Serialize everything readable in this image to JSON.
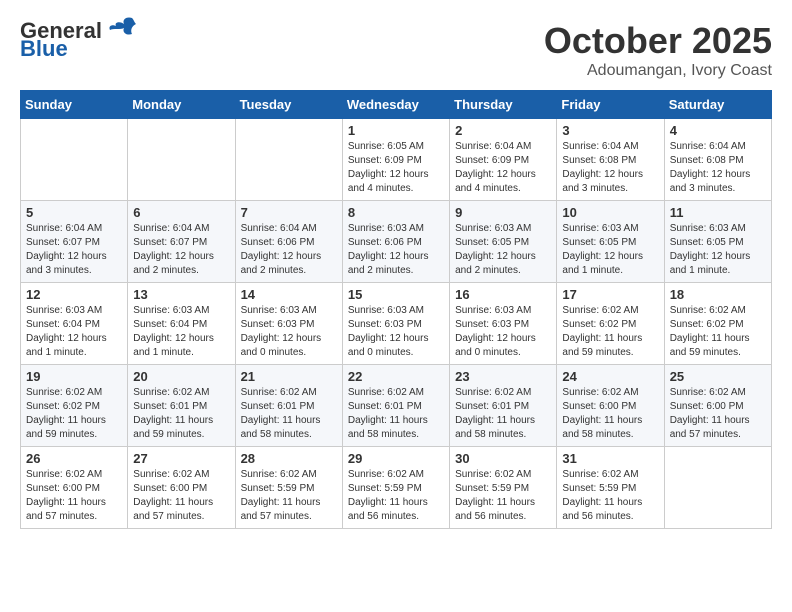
{
  "header": {
    "logo_line1": "General",
    "logo_line2": "Blue",
    "month": "October 2025",
    "location": "Adoumangan, Ivory Coast"
  },
  "weekdays": [
    "Sunday",
    "Monday",
    "Tuesday",
    "Wednesday",
    "Thursday",
    "Friday",
    "Saturday"
  ],
  "weeks": [
    [
      {
        "day": "",
        "content": ""
      },
      {
        "day": "",
        "content": ""
      },
      {
        "day": "",
        "content": ""
      },
      {
        "day": "1",
        "content": "Sunrise: 6:05 AM\nSunset: 6:09 PM\nDaylight: 12 hours\nand 4 minutes."
      },
      {
        "day": "2",
        "content": "Sunrise: 6:04 AM\nSunset: 6:09 PM\nDaylight: 12 hours\nand 4 minutes."
      },
      {
        "day": "3",
        "content": "Sunrise: 6:04 AM\nSunset: 6:08 PM\nDaylight: 12 hours\nand 3 minutes."
      },
      {
        "day": "4",
        "content": "Sunrise: 6:04 AM\nSunset: 6:08 PM\nDaylight: 12 hours\nand 3 minutes."
      }
    ],
    [
      {
        "day": "5",
        "content": "Sunrise: 6:04 AM\nSunset: 6:07 PM\nDaylight: 12 hours\nand 3 minutes."
      },
      {
        "day": "6",
        "content": "Sunrise: 6:04 AM\nSunset: 6:07 PM\nDaylight: 12 hours\nand 2 minutes."
      },
      {
        "day": "7",
        "content": "Sunrise: 6:04 AM\nSunset: 6:06 PM\nDaylight: 12 hours\nand 2 minutes."
      },
      {
        "day": "8",
        "content": "Sunrise: 6:03 AM\nSunset: 6:06 PM\nDaylight: 12 hours\nand 2 minutes."
      },
      {
        "day": "9",
        "content": "Sunrise: 6:03 AM\nSunset: 6:05 PM\nDaylight: 12 hours\nand 2 minutes."
      },
      {
        "day": "10",
        "content": "Sunrise: 6:03 AM\nSunset: 6:05 PM\nDaylight: 12 hours\nand 1 minute."
      },
      {
        "day": "11",
        "content": "Sunrise: 6:03 AM\nSunset: 6:05 PM\nDaylight: 12 hours\nand 1 minute."
      }
    ],
    [
      {
        "day": "12",
        "content": "Sunrise: 6:03 AM\nSunset: 6:04 PM\nDaylight: 12 hours\nand 1 minute."
      },
      {
        "day": "13",
        "content": "Sunrise: 6:03 AM\nSunset: 6:04 PM\nDaylight: 12 hours\nand 1 minute."
      },
      {
        "day": "14",
        "content": "Sunrise: 6:03 AM\nSunset: 6:03 PM\nDaylight: 12 hours\nand 0 minutes."
      },
      {
        "day": "15",
        "content": "Sunrise: 6:03 AM\nSunset: 6:03 PM\nDaylight: 12 hours\nand 0 minutes."
      },
      {
        "day": "16",
        "content": "Sunrise: 6:03 AM\nSunset: 6:03 PM\nDaylight: 12 hours\nand 0 minutes."
      },
      {
        "day": "17",
        "content": "Sunrise: 6:02 AM\nSunset: 6:02 PM\nDaylight: 11 hours\nand 59 minutes."
      },
      {
        "day": "18",
        "content": "Sunrise: 6:02 AM\nSunset: 6:02 PM\nDaylight: 11 hours\nand 59 minutes."
      }
    ],
    [
      {
        "day": "19",
        "content": "Sunrise: 6:02 AM\nSunset: 6:02 PM\nDaylight: 11 hours\nand 59 minutes."
      },
      {
        "day": "20",
        "content": "Sunrise: 6:02 AM\nSunset: 6:01 PM\nDaylight: 11 hours\nand 59 minutes."
      },
      {
        "day": "21",
        "content": "Sunrise: 6:02 AM\nSunset: 6:01 PM\nDaylight: 11 hours\nand 58 minutes."
      },
      {
        "day": "22",
        "content": "Sunrise: 6:02 AM\nSunset: 6:01 PM\nDaylight: 11 hours\nand 58 minutes."
      },
      {
        "day": "23",
        "content": "Sunrise: 6:02 AM\nSunset: 6:01 PM\nDaylight: 11 hours\nand 58 minutes."
      },
      {
        "day": "24",
        "content": "Sunrise: 6:02 AM\nSunset: 6:00 PM\nDaylight: 11 hours\nand 58 minutes."
      },
      {
        "day": "25",
        "content": "Sunrise: 6:02 AM\nSunset: 6:00 PM\nDaylight: 11 hours\nand 57 minutes."
      }
    ],
    [
      {
        "day": "26",
        "content": "Sunrise: 6:02 AM\nSunset: 6:00 PM\nDaylight: 11 hours\nand 57 minutes."
      },
      {
        "day": "27",
        "content": "Sunrise: 6:02 AM\nSunset: 6:00 PM\nDaylight: 11 hours\nand 57 minutes."
      },
      {
        "day": "28",
        "content": "Sunrise: 6:02 AM\nSunset: 5:59 PM\nDaylight: 11 hours\nand 57 minutes."
      },
      {
        "day": "29",
        "content": "Sunrise: 6:02 AM\nSunset: 5:59 PM\nDaylight: 11 hours\nand 56 minutes."
      },
      {
        "day": "30",
        "content": "Sunrise: 6:02 AM\nSunset: 5:59 PM\nDaylight: 11 hours\nand 56 minutes."
      },
      {
        "day": "31",
        "content": "Sunrise: 6:02 AM\nSunset: 5:59 PM\nDaylight: 11 hours\nand 56 minutes."
      },
      {
        "day": "",
        "content": ""
      }
    ]
  ]
}
